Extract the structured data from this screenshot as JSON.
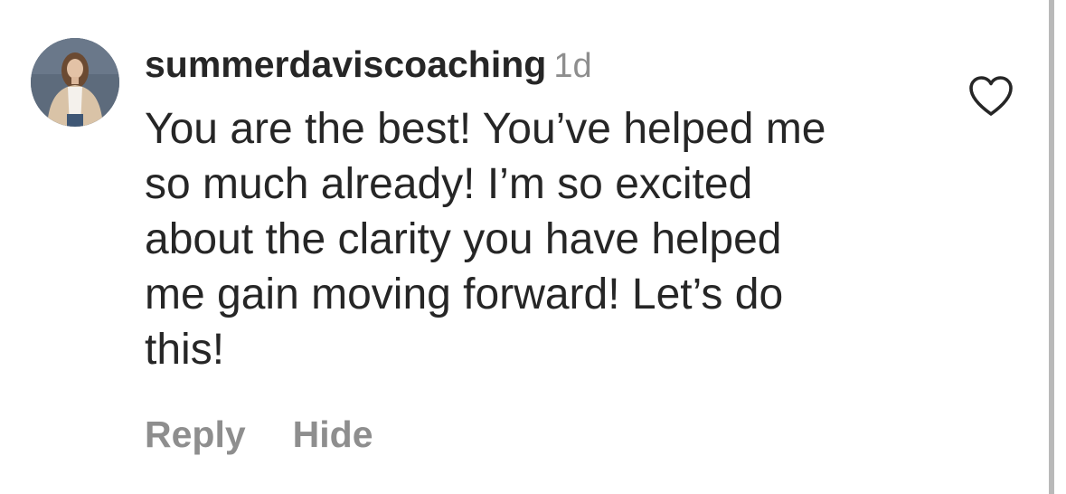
{
  "comment": {
    "username": "summerdaviscoaching",
    "time": "1d",
    "lines": [
      "You are the best! You’ve helped me",
      "so much already! I’m so excited",
      "about the clarity you have helped",
      "me gain moving forward! Let’s do",
      "this!"
    ],
    "actions": {
      "reply": "Reply",
      "hide": "Hide"
    },
    "like_icon": "heart-outline-icon"
  },
  "colors": {
    "text": "#262626",
    "secondary": "#8e8e8e",
    "background": "#ffffff"
  }
}
